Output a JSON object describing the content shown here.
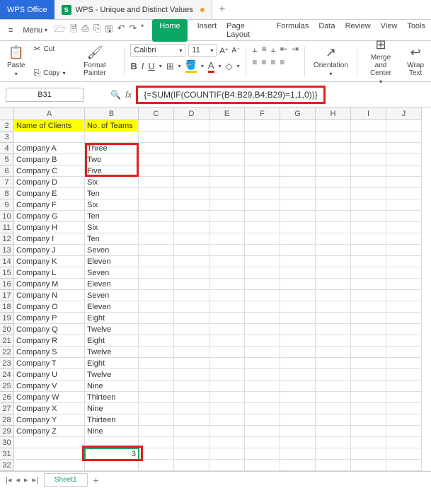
{
  "titlebar": {
    "app_name": "WPS Office",
    "doc_icon": "S",
    "doc_name": "WPS - Unique and Distinct Values",
    "add": "+"
  },
  "menubar": {
    "menu_label": "Menu",
    "qat": [
      "🗁",
      "🗎",
      "⎙",
      "⎘",
      "🖫",
      "↶",
      "↷"
    ],
    "tabs": {
      "home": "Home",
      "insert": "Insert",
      "page": "Page Layout",
      "formulas": "Formulas",
      "data": "Data",
      "review": "Review",
      "view": "View",
      "tools": "Tools"
    }
  },
  "ribbon": {
    "paste": "Paste",
    "cut": "Cut",
    "copy": "Copy",
    "format_painter": "Format Painter",
    "font": "Calibri",
    "size": "11",
    "orientation": "Orientation",
    "merge": "Merge and Center",
    "wrap": "Wrap Text"
  },
  "formula": {
    "namebox": "B31",
    "fx": "fx",
    "text": "{=SUM(IF(COUNTIF(B4:B29,B4:B29)=1,1,0))}"
  },
  "columns": [
    "A",
    "B",
    "C",
    "D",
    "E",
    "F",
    "G",
    "H",
    "I",
    "J"
  ],
  "rows": [
    2,
    3,
    4,
    5,
    6,
    7,
    8,
    9,
    10,
    11,
    12,
    13,
    14,
    15,
    16,
    17,
    18,
    19,
    20,
    21,
    22,
    23,
    24,
    25,
    26,
    27,
    28,
    29,
    30,
    31,
    32
  ],
  "headers": {
    "a": "Name of Clients",
    "b": "No. of Teams"
  },
  "data": [
    {
      "a": "Company A",
      "b": "Three"
    },
    {
      "a": "Company B",
      "b": "Two"
    },
    {
      "a": "Company C",
      "b": "Five"
    },
    {
      "a": "Company D",
      "b": "Six"
    },
    {
      "a": "Company E",
      "b": "Ten"
    },
    {
      "a": "Company F",
      "b": "Six"
    },
    {
      "a": "Company G",
      "b": "Ten"
    },
    {
      "a": "Company H",
      "b": "Six"
    },
    {
      "a": "Company I",
      "b": "Ten"
    },
    {
      "a": "Company J",
      "b": "Seven"
    },
    {
      "a": "Company K",
      "b": "Eleven"
    },
    {
      "a": "Company L",
      "b": "Seven"
    },
    {
      "a": "Company M",
      "b": "Eleven"
    },
    {
      "a": "Company N",
      "b": "Seven"
    },
    {
      "a": "Company O",
      "b": "Eleven"
    },
    {
      "a": "Company P",
      "b": "Eight"
    },
    {
      "a": "Company Q",
      "b": "Twelve"
    },
    {
      "a": "Company R",
      "b": "Eight"
    },
    {
      "a": "Company S",
      "b": "Twelve"
    },
    {
      "a": "Company T",
      "b": "Eight"
    },
    {
      "a": "Company U",
      "b": "Twelve"
    },
    {
      "a": "Company V",
      "b": "Nine"
    },
    {
      "a": "Company W",
      "b": "Thirteen"
    },
    {
      "a": "Company X",
      "b": "Nine"
    },
    {
      "a": "Company Y",
      "b": "Thirteen"
    },
    {
      "a": "Company Z",
      "b": "Nine"
    }
  ],
  "active_value": "3",
  "sheet": {
    "name": "Sheet1",
    "add": "+"
  }
}
